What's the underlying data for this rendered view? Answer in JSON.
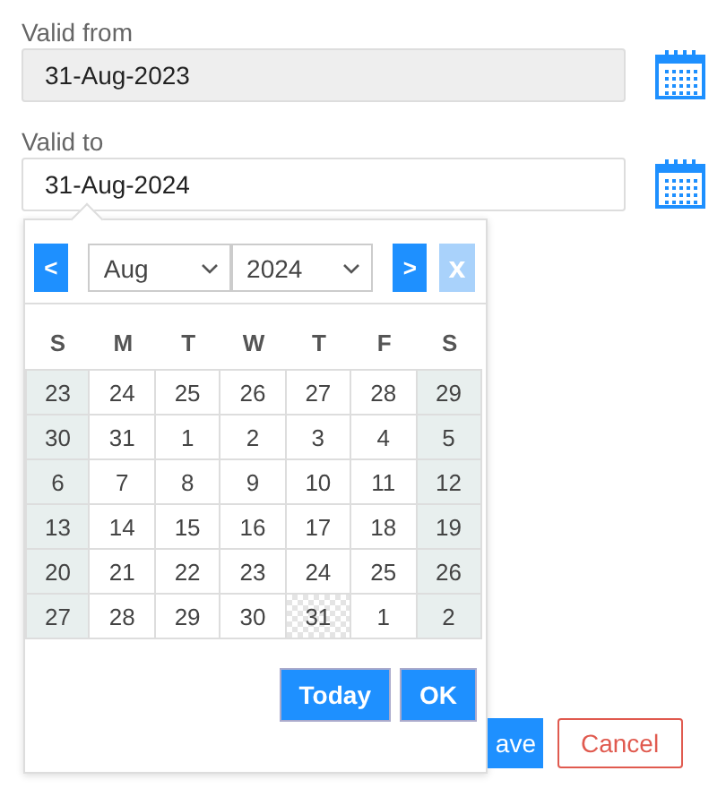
{
  "fields": [
    {
      "label": "Valid from",
      "value": "31-Aug-2023",
      "disabled": true
    },
    {
      "label": "Valid to",
      "value": "31-Aug-2024",
      "disabled": false
    }
  ],
  "datepicker": {
    "prev": "<",
    "month": "Aug",
    "year": "2024",
    "next": ">",
    "clear": {
      "label": "x",
      "disabled": true
    },
    "weekdays": [
      "S",
      "M",
      "T",
      "W",
      "T",
      "F",
      "S"
    ],
    "weeks": [
      [
        {
          "day": "23",
          "selected": false
        },
        {
          "day": "24",
          "selected": false
        },
        {
          "day": "25",
          "selected": false
        },
        {
          "day": "26",
          "selected": false
        },
        {
          "day": "27",
          "selected": false
        },
        {
          "day": "28",
          "selected": false
        },
        {
          "day": "29",
          "selected": false
        }
      ],
      [
        {
          "day": "30",
          "selected": false
        },
        {
          "day": "31",
          "selected": false
        },
        {
          "day": "1",
          "selected": false
        },
        {
          "day": "2",
          "selected": false
        },
        {
          "day": "3",
          "selected": false
        },
        {
          "day": "4",
          "selected": false
        },
        {
          "day": "5",
          "selected": false
        }
      ],
      [
        {
          "day": "6",
          "selected": false
        },
        {
          "day": "7",
          "selected": false
        },
        {
          "day": "8",
          "selected": false
        },
        {
          "day": "9",
          "selected": false
        },
        {
          "day": "10",
          "selected": false
        },
        {
          "day": "11",
          "selected": false
        },
        {
          "day": "12",
          "selected": false
        }
      ],
      [
        {
          "day": "13",
          "selected": false
        },
        {
          "day": "14",
          "selected": false
        },
        {
          "day": "15",
          "selected": false
        },
        {
          "day": "16",
          "selected": false
        },
        {
          "day": "17",
          "selected": false
        },
        {
          "day": "18",
          "selected": false
        },
        {
          "day": "19",
          "selected": false
        }
      ],
      [
        {
          "day": "20",
          "selected": false
        },
        {
          "day": "21",
          "selected": false
        },
        {
          "day": "22",
          "selected": false
        },
        {
          "day": "23",
          "selected": false
        },
        {
          "day": "24",
          "selected": false
        },
        {
          "day": "25",
          "selected": false
        },
        {
          "day": "26",
          "selected": false
        }
      ],
      [
        {
          "day": "27",
          "selected": false
        },
        {
          "day": "28",
          "selected": false
        },
        {
          "day": "29",
          "selected": false
        },
        {
          "day": "30",
          "selected": false
        },
        {
          "day": "31",
          "selected": true
        },
        {
          "day": "1",
          "selected": false
        },
        {
          "day": "2",
          "selected": false
        }
      ]
    ],
    "today": "Today",
    "ok": "OK"
  },
  "actions": {
    "save": "ave",
    "cancel": "Cancel"
  }
}
